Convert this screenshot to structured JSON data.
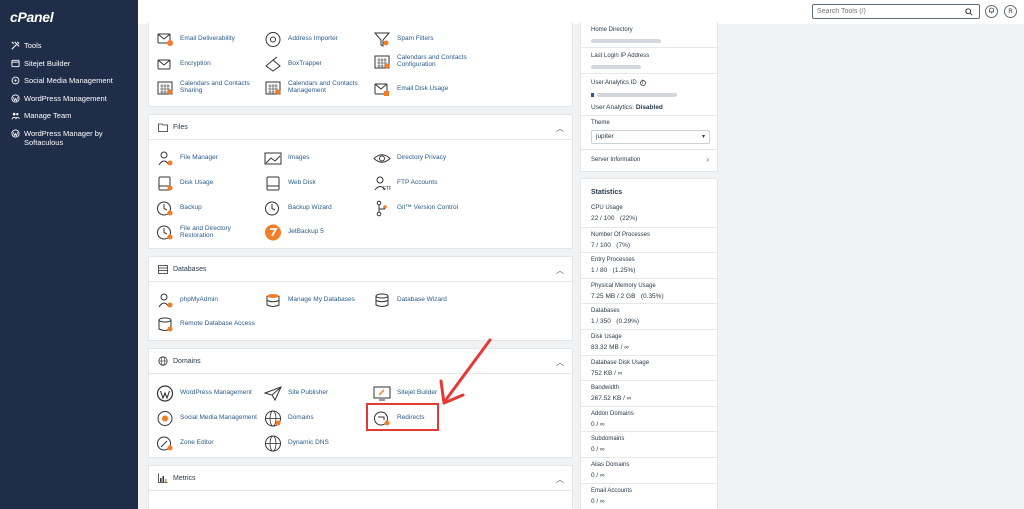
{
  "brand": {
    "logo": "cPanel"
  },
  "sidebar": {
    "items": [
      {
        "label": "Tools",
        "icon": "tools-icon"
      },
      {
        "label": "Sitejet Builder",
        "icon": "sitejet-icon"
      },
      {
        "label": "Social Media Management",
        "icon": "social-media-icon"
      },
      {
        "label": "WordPress Management",
        "icon": "wordpress-icon"
      },
      {
        "label": "Manage Team",
        "icon": "team-icon"
      },
      {
        "label": "WordPress Manager by Softaculous",
        "icon": "wordpress-icon"
      }
    ]
  },
  "topbar": {
    "search_placeholder": "Search Tools (/)",
    "user_initial": "R"
  },
  "email": {
    "tools": [
      {
        "label": "Email Deliverability",
        "icon": "email-deliverability-icon"
      },
      {
        "label": "Address Importer",
        "icon": "at-sign-icon"
      },
      {
        "label": "Spam Filters",
        "icon": "filter-icon"
      },
      {
        "label": "Encryption",
        "icon": "encryption-icon"
      },
      {
        "label": "BoxTrapper",
        "icon": "boxtrapper-icon"
      },
      {
        "label": "Calendars and Contacts Configuration",
        "icon": "calendar-icon"
      },
      {
        "label": "Calendars and Contacts Sharing",
        "icon": "calendar-icon"
      },
      {
        "label": "Calendars and Contacts Management",
        "icon": "calendar-icon"
      },
      {
        "label": "Email Disk Usage",
        "icon": "email-disk-usage-icon"
      }
    ]
  },
  "files": {
    "title": "Files",
    "tools": [
      {
        "label": "File Manager",
        "icon": "file-manager-icon"
      },
      {
        "label": "Images",
        "icon": "images-icon"
      },
      {
        "label": "Directory Privacy",
        "icon": "eye-icon"
      },
      {
        "label": "Disk Usage",
        "icon": "disk-usage-icon"
      },
      {
        "label": "Web Disk",
        "icon": "web-disk-icon"
      },
      {
        "label": "FTP Accounts",
        "icon": "ftp-icon"
      },
      {
        "label": "Backup",
        "icon": "backup-icon"
      },
      {
        "label": "Backup Wizard",
        "icon": "backup-wizard-icon"
      },
      {
        "label": "Git™ Version Control",
        "icon": "git-icon"
      },
      {
        "label": "File and Directory Restoration",
        "icon": "restore-icon"
      },
      {
        "label": "JetBackup 5",
        "icon": "jetbackup-icon"
      }
    ]
  },
  "databases": {
    "title": "Databases",
    "tools": [
      {
        "label": "phpMyAdmin",
        "icon": "phpmyadmin-icon"
      },
      {
        "label": "Manage My Databases",
        "icon": "database-icon"
      },
      {
        "label": "Database Wizard",
        "icon": "database-wizard-icon"
      },
      {
        "label": "Remote Database Access",
        "icon": "remote-database-icon"
      }
    ]
  },
  "domains": {
    "title": "Domains",
    "tools": [
      {
        "label": "WordPress Management",
        "icon": "wordpress-icon"
      },
      {
        "label": "Site Publisher",
        "icon": "paper-plane-icon"
      },
      {
        "label": "Sitejet Builder",
        "icon": "sitejet-icon"
      },
      {
        "label": "Social Media Management",
        "icon": "social-media-icon"
      },
      {
        "label": "Domains",
        "icon": "globe-icon"
      },
      {
        "label": "Redirects",
        "icon": "redirect-icon"
      },
      {
        "label": "Zone Editor",
        "icon": "zone-editor-icon"
      },
      {
        "label": "Dynamic DNS",
        "icon": "dynamic-dns-icon"
      }
    ]
  },
  "metrics": {
    "title": "Metrics"
  },
  "general_info": {
    "home_directory_label": "Home Directory",
    "last_login_label": "Last Login IP Address",
    "user_analytics_id_label": "User Analytics ID",
    "user_analytics_label": "User Analytics:",
    "user_analytics_value": "Disabled",
    "theme_label": "Theme",
    "theme_value": "jupiter",
    "server_info_link": "Server Information"
  },
  "statistics": {
    "title": "Statistics",
    "rows": [
      {
        "label": "CPU Usage",
        "value": "22 / 100   (22%)"
      },
      {
        "label": "Number Of Processes",
        "value": "7 / 100   (7%)"
      },
      {
        "label": "Entry Processes",
        "value": "1 / 80   (1.25%)"
      },
      {
        "label": "Physical Memory Usage",
        "value": "7.25 MB / 2 GB   (0.35%)"
      },
      {
        "label": "Databases",
        "value": "1 / 350   (0.29%)"
      },
      {
        "label": "Disk Usage",
        "value": "83.32 MB / ∞"
      },
      {
        "label": "Database Disk Usage",
        "value": "752 KB / ∞"
      },
      {
        "label": "Bandwidth",
        "value": "267.52 KB / ∞"
      },
      {
        "label": "Addon Domains",
        "value": "0 / ∞"
      },
      {
        "label": "Subdomains",
        "value": "0 / ∞"
      },
      {
        "label": "Alias Domains",
        "value": "0 / ∞"
      },
      {
        "label": "Email Accounts",
        "value": "0 / ∞"
      }
    ]
  },
  "colors": {
    "sidebar_bg": "#1f2d48",
    "link": "#2a5b8c",
    "icon_orange": "#f27d26",
    "annotation_red": "#e53935"
  }
}
